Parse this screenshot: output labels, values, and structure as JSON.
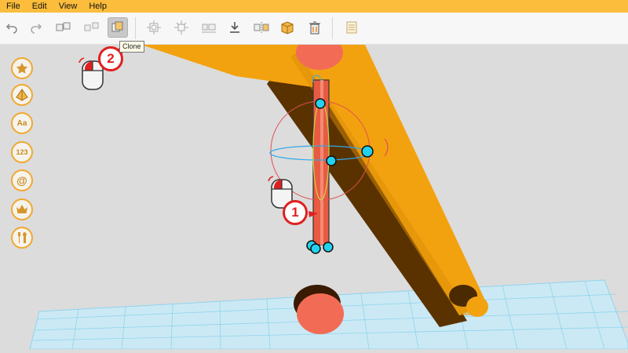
{
  "menubar": {
    "items": [
      "File",
      "Edit",
      "View",
      "Help"
    ]
  },
  "toolbar": {
    "buttons": [
      {
        "name": "undo-icon"
      },
      {
        "name": "redo-icon"
      },
      {
        "name": "group-icon"
      },
      {
        "name": "ungroup-icon"
      },
      {
        "name": "clone-icon",
        "active": true
      },
      {
        "name": "align-icon"
      },
      {
        "name": "distribute-icon"
      },
      {
        "name": "layout-icon"
      },
      {
        "name": "drop-to-platform-icon"
      },
      {
        "name": "mirror-icon"
      },
      {
        "name": "box-icon"
      },
      {
        "name": "delete-icon"
      },
      {
        "name": "notes-icon"
      }
    ],
    "tooltip": "Clone"
  },
  "sidebar": {
    "items": [
      {
        "name": "favorites",
        "icon": "star-icon"
      },
      {
        "name": "shapes",
        "icon": "pyramid-icon"
      },
      {
        "name": "text",
        "label": "Aa"
      },
      {
        "name": "numbers",
        "label": "123"
      },
      {
        "name": "symbols",
        "label": "@"
      },
      {
        "name": "crown",
        "icon": "crown-icon"
      },
      {
        "name": "tools",
        "icon": "tools-icon"
      }
    ]
  },
  "callouts": {
    "step1": "1",
    "step2": "2"
  },
  "colors": {
    "menubar": "#fbbd3b",
    "model_orange": "#f3a20f",
    "cylinder": "#f26c55",
    "handle": "#22d2ee",
    "grid": "#8fd4ee",
    "callout_red": "#e02020"
  }
}
